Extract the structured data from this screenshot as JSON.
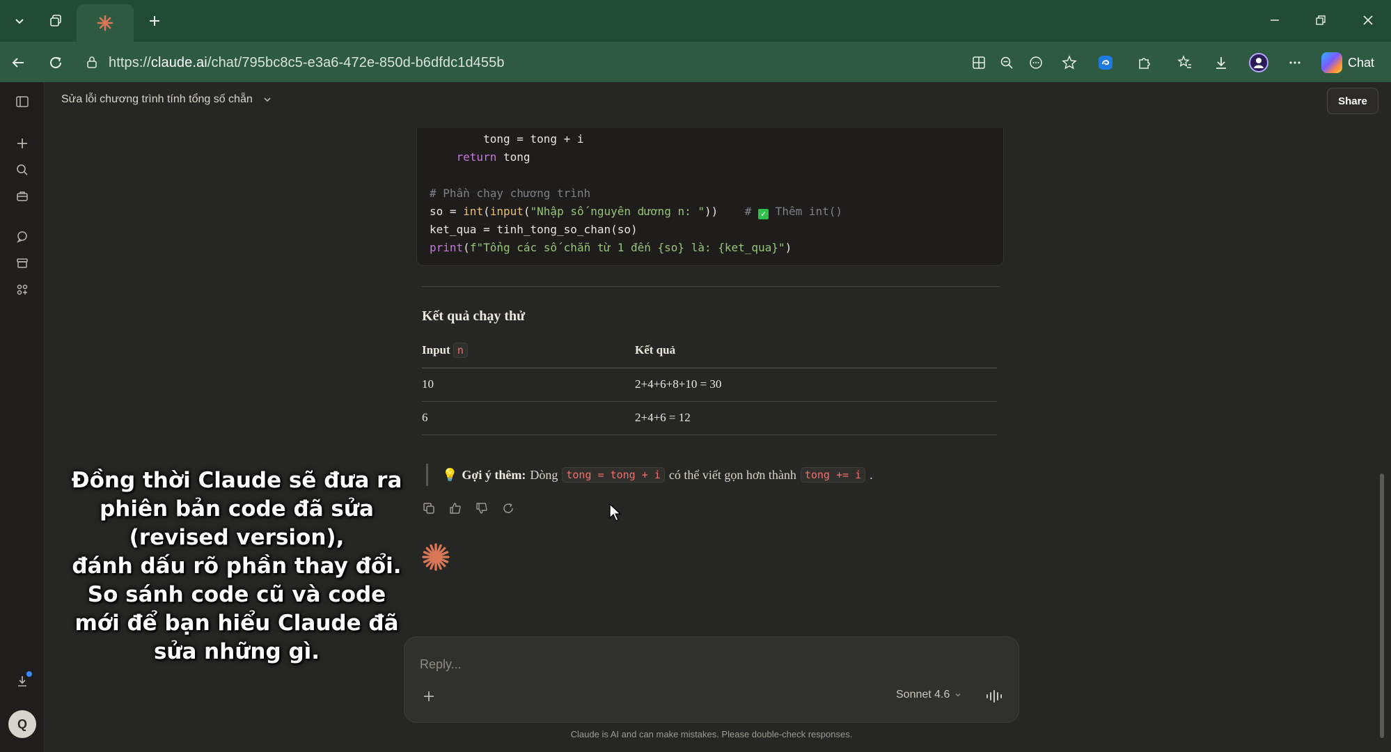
{
  "browser": {
    "url_prefix": "https://",
    "url_host": "claude.ai",
    "url_path": "/chat/795bc8c5-e3a6-472e-850d-b6dfdc1d455b",
    "chat_button_label": "Chat"
  },
  "app": {
    "chat_title": "Sửa lỗi chương trình tính tổng số chẵn",
    "share_label": "Share",
    "user_initial": "Q"
  },
  "code": {
    "line1": "        tong = tong + i",
    "line2_kw": "    return",
    "line2_rest": " tong",
    "line3": "# Phần chạy chương trình",
    "line4_a": "so = ",
    "line4_fn1": "int",
    "line4_b": "(",
    "line4_fn2": "input",
    "line4_c": "(",
    "line4_str": "\"Nhập số nguyên dương n: \"",
    "line4_d": "))",
    "line4_cmt1": "    # ",
    "line4_cmt2": " Thêm int()",
    "line5": "ket_qua = tinh_tong_so_chan(so)",
    "line6_kw": "print",
    "line6_b": "(",
    "line6_str": "f\"Tổng các số chẵn từ 1 đến {so} là: {ket_qua}\"",
    "line6_c": ")"
  },
  "results": {
    "title": "Kết quả chạy thử",
    "col_input": "Input",
    "col_input_code": "n",
    "col_result": "Kết quả",
    "rows": [
      {
        "input": "10",
        "result": "2+4+6+8+10 = 30"
      },
      {
        "input": "6",
        "result": "2+4+6 = 12"
      }
    ]
  },
  "tip": {
    "emoji": "💡",
    "label": "Gợi ý thêm:",
    "text1": "Dòng",
    "code1": "tong = tong + i",
    "text2": "có thể viết gọn hơn thành",
    "code2": "tong += i",
    "text3": "."
  },
  "caption": {
    "lines": [
      "Đồng thời Claude sẽ đưa ra",
      "phiên bản code đã sửa",
      "(revised version),",
      "đánh dấu rõ phần thay đổi.",
      "So sánh code cũ và code",
      "mới để bạn hiểu Claude đã",
      "sửa những gì."
    ]
  },
  "composer": {
    "placeholder": "Reply...",
    "model": "Sonnet 4.6"
  },
  "disclaimer": "Claude is AI and can make mistakes. Please double-check responses.",
  "colors": {
    "accent": "#d97757",
    "tab_bar": "#214b34",
    "address_bar": "#2f5a42",
    "background": "#262624"
  }
}
